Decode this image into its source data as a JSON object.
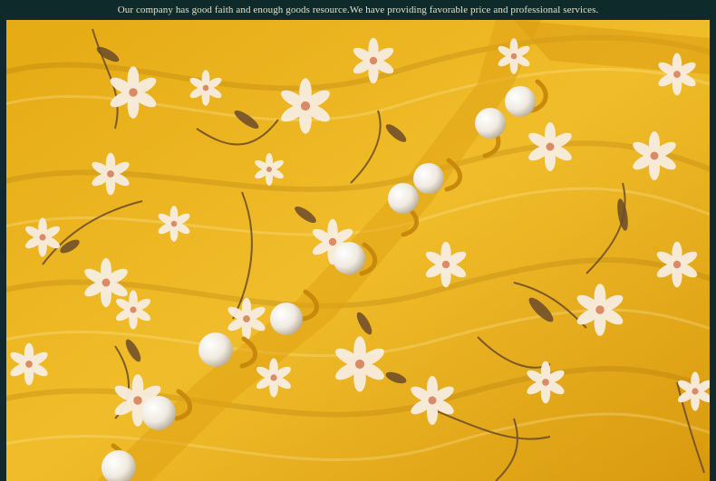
{
  "banner": {
    "text": "Our company has good faith and enough goods resource.We have providing favorable price and professional services."
  },
  "photo": {
    "subject": "yellow-floral-chiffon-blouse-with-pearl-buttons",
    "fabric_color": "#e9b21c",
    "flower_color": "#f6ecdf",
    "stem_color": "#6a4a2a",
    "pearl_color": "#f4f1ea",
    "loop_color": "#d89a12",
    "frame_color": "#0f2a2b"
  }
}
